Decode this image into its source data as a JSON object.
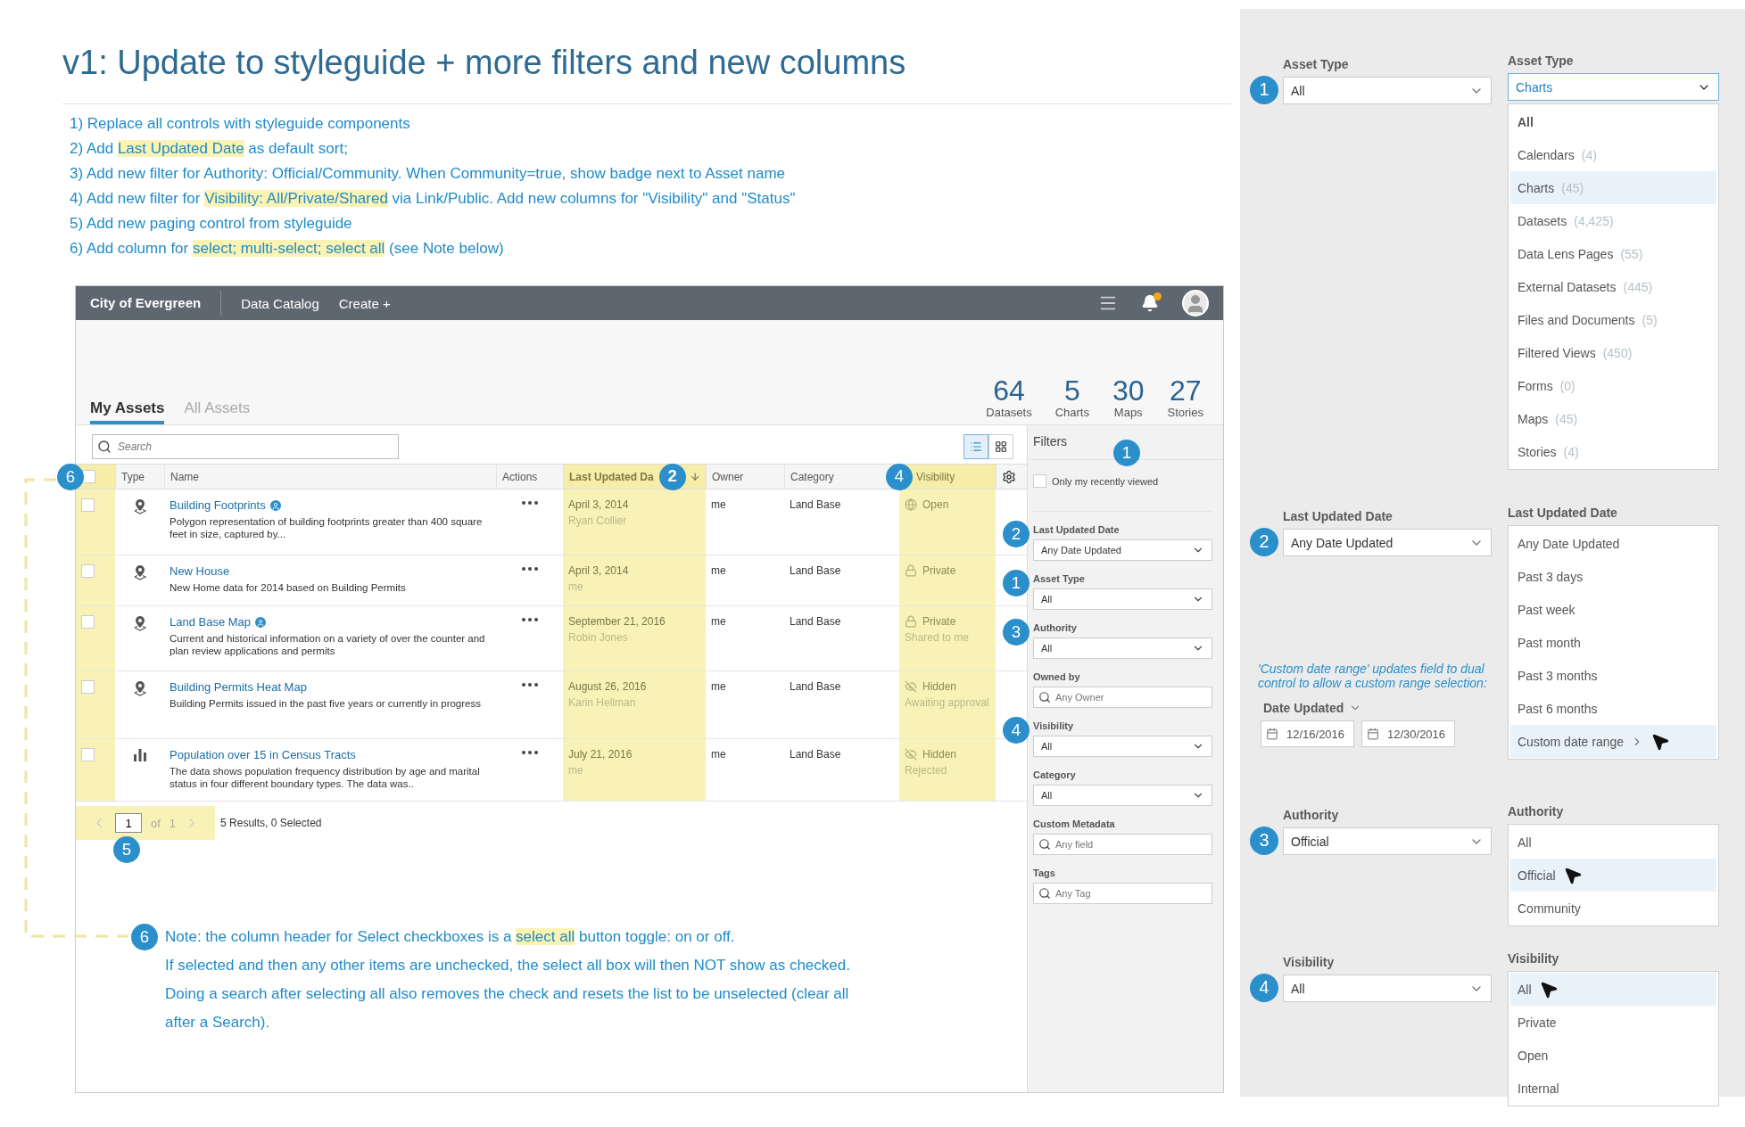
{
  "title": "v1: Update to styleguide + more filters and new columns",
  "notes": [
    [
      {
        "text": "1) Replace all controls with styleguide components",
        "highlight": false
      }
    ],
    [
      {
        "text": "2) Add ",
        "highlight": false
      },
      {
        "text": "Last Updated Date",
        "highlight": true
      },
      {
        "text": " as default sort;",
        "highlight": false
      }
    ],
    [
      {
        "text": "3) Add new filter for Authority: Official/Community. When Community=true, show badge next to Asset name",
        "highlight": false
      }
    ],
    [
      {
        "text": "4) Add new filter for ",
        "highlight": false
      },
      {
        "text": "Visibility: All/Private/Shared",
        "highlight": true
      },
      {
        "text": " via Link/Public. Add new columns for \"Visibility\" and \"Status\"",
        "highlight": false
      }
    ],
    [
      {
        "text": "5) Add new paging control from styleguide",
        "highlight": false
      }
    ],
    [
      {
        "text": "6) Add column for ",
        "highlight": false
      },
      {
        "text": "select; multi-select; select all",
        "highlight": true
      },
      {
        "text": " (see Note below)",
        "highlight": false
      }
    ]
  ],
  "app": {
    "nav": {
      "brand": "City of Evergreen",
      "links": [
        "Data Catalog",
        "Create +"
      ],
      "has_notification": true
    },
    "stats": [
      {
        "value": "64",
        "label": "Datasets"
      },
      {
        "value": "5",
        "label": "Charts"
      },
      {
        "value": "30",
        "label": "Maps"
      },
      {
        "value": "27",
        "label": "Stories"
      }
    ],
    "tabs": [
      {
        "label": "My Assets",
        "selected": true
      },
      {
        "label": "All Assets",
        "selected": false
      }
    ],
    "search": {
      "placeholder": "Search"
    },
    "view_toggle": [
      {
        "kind": "list",
        "selected": true
      },
      {
        "kind": "grid",
        "selected": false
      }
    ],
    "columns": [
      {
        "kind": "select",
        "highlighted": true,
        "badge": "6"
      },
      {
        "kind": "type",
        "label": "Type",
        "highlighted": false
      },
      {
        "kind": "name",
        "label": "Name",
        "highlighted": false
      },
      {
        "kind": "actions",
        "label": "Actions",
        "highlighted": false
      },
      {
        "kind": "date",
        "label": "Last Updated Da",
        "highlighted": true,
        "badge": "2",
        "sorted": true
      },
      {
        "kind": "owner",
        "label": "Owner",
        "highlighted": false
      },
      {
        "kind": "category",
        "label": "Category",
        "highlighted": false
      },
      {
        "kind": "visibility",
        "label": "Visibility",
        "highlighted": true,
        "badge": "4"
      },
      {
        "kind": "settings",
        "highlighted": false
      }
    ],
    "rows": [
      {
        "checked": false,
        "kind": "map",
        "name": "Building Footprints",
        "community": true,
        "description": "Polygon representation of building footprints greater than 400 square feet in size, captured by...",
        "date": "April 3, 2014",
        "updated_by": "Ryan Collier",
        "owner": "me",
        "category": "Land Base",
        "visibility": {
          "kind": "open",
          "label": "Open"
        }
      },
      {
        "checked": false,
        "kind": "map",
        "name": "New House",
        "community": false,
        "description": "New Home data for 2014 based on Building Permits",
        "date": "April 3, 2014",
        "updated_by": "me",
        "owner": "me",
        "category": "Land Base",
        "visibility": {
          "kind": "private",
          "label": "Private"
        }
      },
      {
        "checked": false,
        "kind": "map",
        "name": "Land Base Map",
        "community": true,
        "description": "Current and historical information on a variety of over the counter and plan review applications and permits",
        "date": "September 21, 2016",
        "updated_by": "Robin Jones",
        "owner": "me",
        "category": "Land Base",
        "visibility": {
          "kind": "private",
          "label": "Private",
          "note": "Shared to me"
        }
      },
      {
        "checked": false,
        "kind": "map",
        "name": "Building Permits Heat Map",
        "community": false,
        "description": "Building Permits issued in the past five years or currently in progress",
        "date": "August 26, 2016",
        "updated_by": "Karin Hellman",
        "owner": "me",
        "category": "Land Base",
        "visibility": {
          "kind": "hidden",
          "label": "Hidden",
          "note": "Awaiting approval"
        }
      },
      {
        "checked": false,
        "kind": "chart",
        "name": "Population over 15 in Census Tracts",
        "community": false,
        "description": "The data shows population frequency distribution by age and marital status in four different boundary types. The data was..",
        "date": "July 21, 2016",
        "updated_by": "me",
        "owner": "me",
        "category": "Land Base",
        "visibility": {
          "kind": "hidden",
          "label": "Hidden",
          "note": "Rejected"
        }
      }
    ],
    "pager": {
      "page": "1",
      "of": "of",
      "total": "1",
      "summary": "5 Results, 0 Selected",
      "badge": "5",
      "highlighted": true
    },
    "filters": {
      "title": "Filters",
      "badge": "1",
      "recent": {
        "label": "Only my recently viewed",
        "checked": false
      },
      "items": [
        {
          "kind": "select",
          "label": "Last Updated Date",
          "value": "Any Date Updated",
          "badge": "2"
        },
        {
          "kind": "select",
          "label": "Asset Type",
          "value": "All",
          "badge": "1"
        },
        {
          "kind": "select",
          "label": "Authority",
          "value": "All",
          "badge": "3"
        },
        {
          "kind": "search",
          "label": "Owned by",
          "placeholder": "Any Owner"
        },
        {
          "kind": "select",
          "label": "Visibility",
          "value": "All",
          "badge": "4"
        },
        {
          "kind": "select",
          "label": "Category",
          "value": "All"
        },
        {
          "kind": "search",
          "label": "Custom Metadata",
          "placeholder": "Any field"
        },
        {
          "kind": "search",
          "label": "Tags",
          "placeholder": "Any Tag"
        }
      ]
    }
  },
  "note": {
    "badge": "6",
    "lines": [
      [
        {
          "text": "Note: the column header for Select checkboxes is a ",
          "highlight": false
        },
        {
          "text": "select all",
          "highlight": true
        },
        {
          "text": " button toggle: on or off.",
          "highlight": false
        }
      ],
      [
        {
          "text": "If selected and then any other items are unchecked, the select all box will then NOT show as checked.",
          "highlight": false
        }
      ],
      [
        {
          "text": "Doing a search after selecting all also removes the check and resets the list to be unselected (clear all",
          "highlight": false
        }
      ],
      [
        {
          "text": "after a Search).",
          "highlight": false
        }
      ]
    ]
  },
  "specs": [
    {
      "badge": "1",
      "closed": {
        "label": "Asset Type",
        "value": "All"
      },
      "open": {
        "label": "Asset Type",
        "value": "Charts",
        "options": [
          {
            "label": "All",
            "bold": true,
            "selected": false
          },
          {
            "label": "Calendars",
            "count": "(4)",
            "bold": false,
            "selected": false
          },
          {
            "label": "Charts",
            "count": "(45)",
            "bold": false,
            "selected": true
          },
          {
            "label": "Datasets",
            "count": "(4,425)",
            "bold": false,
            "selected": false
          },
          {
            "label": "Data Lens Pages",
            "count": "(55)",
            "bold": false,
            "selected": false
          },
          {
            "label": "External Datasets",
            "count": "(445)",
            "bold": false,
            "selected": false
          },
          {
            "label": "Files and Documents",
            "count": "(5)",
            "bold": false,
            "selected": false
          },
          {
            "label": "Filtered Views",
            "count": "(450)",
            "bold": false,
            "selected": false
          },
          {
            "label": "Forms",
            "count": "(0)",
            "bold": false,
            "selected": false
          },
          {
            "label": "Maps",
            "count": "(45)",
            "bold": false,
            "selected": false
          },
          {
            "label": "Stories",
            "count": "(4)",
            "bold": false,
            "selected": false
          }
        ]
      }
    },
    {
      "badge": "2",
      "closed": {
        "label": "Last Updated Date",
        "value": "Any Date Updated"
      },
      "custom_range": {
        "caption": "'Custom date range' updates field to dual control to allow a custom range selection:",
        "label": "Date Updated",
        "from": "12/16/2016",
        "to": "12/30/2016"
      },
      "open": {
        "label": "Last Updated Date",
        "options": [
          {
            "label": "Any Date Updated",
            "selected": false
          },
          {
            "label": "Past 3 days",
            "selected": false
          },
          {
            "label": "Past week",
            "selected": false
          },
          {
            "label": "Past month",
            "selected": false
          },
          {
            "label": "Past 3 months",
            "selected": false
          },
          {
            "label": "Past 6 months",
            "selected": false
          },
          {
            "label": "Custom date range",
            "selected": true,
            "submenu": true,
            "pointer": true
          }
        ]
      }
    },
    {
      "badge": "3",
      "closed": {
        "label": "Authority",
        "value": "Official"
      },
      "open": {
        "label": "Authority",
        "options": [
          {
            "label": "All",
            "selected": false
          },
          {
            "label": "Official",
            "selected": true,
            "pointer": true
          },
          {
            "label": "Community",
            "selected": false
          }
        ]
      }
    },
    {
      "badge": "4",
      "closed": {
        "label": "Visibility",
        "value": "All"
      },
      "open": {
        "label": "Visibility",
        "options": [
          {
            "label": "All",
            "selected": true,
            "pointer": true
          },
          {
            "label": "Private",
            "selected": false
          },
          {
            "label": "Open",
            "selected": false
          },
          {
            "label": "Internal",
            "selected": false
          }
        ]
      }
    }
  ]
}
